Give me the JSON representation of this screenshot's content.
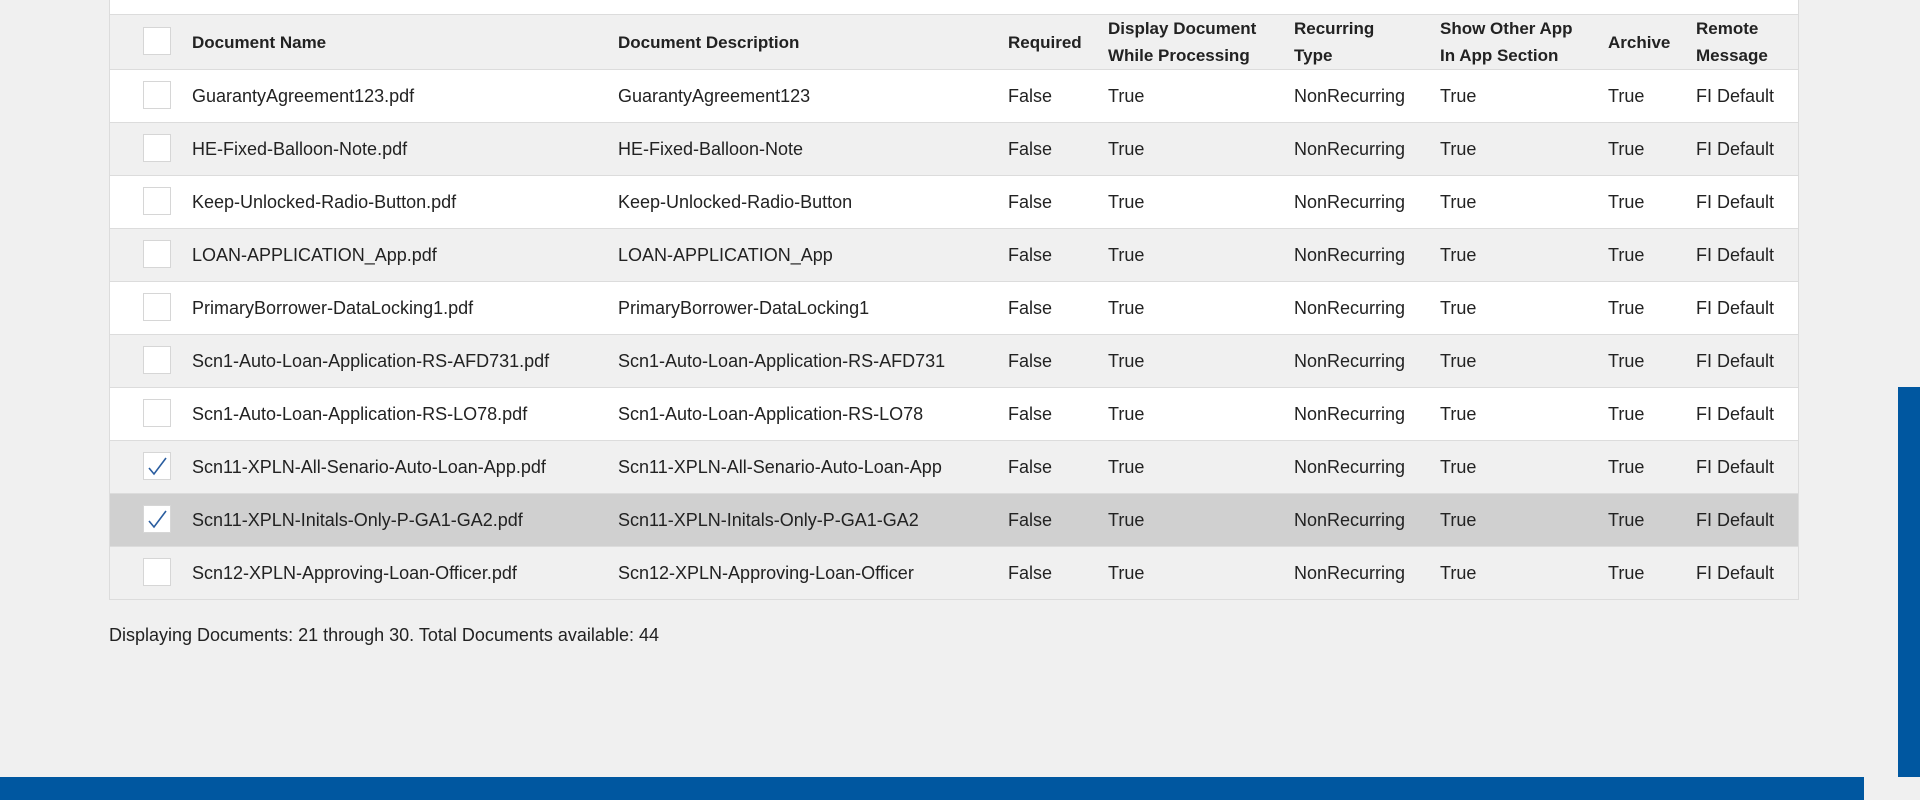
{
  "table": {
    "headers": {
      "name": "Document Name",
      "description": "Document Description",
      "required": "Required",
      "display_while_processing": "Display Document While Processing",
      "recurring_type": "Recurring Type",
      "show_other_app": "Show Other App In App Section",
      "archive": "Archive",
      "remote_message": "Remote Message"
    },
    "rows": [
      {
        "name": "GuarantyAgreement123.pdf",
        "description": "GuarantyAgreement123",
        "required": "False",
        "display": "True",
        "recurring": "NonRecurring",
        "show_other": "True",
        "archive": "True",
        "remote": "FI Default",
        "checked": false
      },
      {
        "name": "HE-Fixed-Balloon-Note.pdf",
        "description": "HE-Fixed-Balloon-Note",
        "required": "False",
        "display": "True",
        "recurring": "NonRecurring",
        "show_other": "True",
        "archive": "True",
        "remote": "FI Default",
        "checked": false
      },
      {
        "name": "Keep-Unlocked-Radio-Button.pdf",
        "description": "Keep-Unlocked-Radio-Button",
        "required": "False",
        "display": "True",
        "recurring": "NonRecurring",
        "show_other": "True",
        "archive": "True",
        "remote": "FI Default",
        "checked": false
      },
      {
        "name": "LOAN-APPLICATION_App.pdf",
        "description": "LOAN-APPLICATION_App",
        "required": "False",
        "display": "True",
        "recurring": "NonRecurring",
        "show_other": "True",
        "archive": "True",
        "remote": "FI Default",
        "checked": false
      },
      {
        "name": "PrimaryBorrower-DataLocking1.pdf",
        "description": "PrimaryBorrower-DataLocking1",
        "required": "False",
        "display": "True",
        "recurring": "NonRecurring",
        "show_other": "True",
        "archive": "True",
        "remote": "FI Default",
        "checked": false
      },
      {
        "name": "Scn1-Auto-Loan-Application-RS-AFD731.pdf",
        "description": "Scn1-Auto-Loan-Application-RS-AFD731",
        "required": "False",
        "display": "True",
        "recurring": "NonRecurring",
        "show_other": "True",
        "archive": "True",
        "remote": "FI Default",
        "checked": false
      },
      {
        "name": "Scn1-Auto-Loan-Application-RS-LO78.pdf",
        "description": "Scn1-Auto-Loan-Application-RS-LO78",
        "required": "False",
        "display": "True",
        "recurring": "NonRecurring",
        "show_other": "True",
        "archive": "True",
        "remote": "FI Default",
        "checked": false
      },
      {
        "name": "Scn11-XPLN-All-Senario-Auto-Loan-App.pdf",
        "description": "Scn11-XPLN-All-Senario-Auto-Loan-App",
        "required": "False",
        "display": "True",
        "recurring": "NonRecurring",
        "show_other": "True",
        "archive": "True",
        "remote": "FI Default",
        "checked": true
      },
      {
        "name": "Scn11-XPLN-Initals-Only-P-GA1-GA2.pdf",
        "description": "Scn11-XPLN-Initals-Only-P-GA1-GA2",
        "required": "False",
        "display": "True",
        "recurring": "NonRecurring",
        "show_other": "True",
        "archive": "True",
        "remote": "FI Default",
        "checked": true,
        "selected": true
      },
      {
        "name": "Scn12-XPLN-Approving-Loan-Officer.pdf",
        "description": "Scn12-XPLN-Approving-Loan-Officer",
        "required": "False",
        "display": "True",
        "recurring": "NonRecurring",
        "show_other": "True",
        "archive": "True",
        "remote": "FI Default",
        "checked": false
      }
    ]
  },
  "footer": {
    "status_text": "Displaying Documents: 21 through 30. Total Documents available: 44"
  },
  "colors": {
    "accent": "#0057a0",
    "check": "#2a5d9f",
    "selected_row": "#d0d0d0"
  }
}
